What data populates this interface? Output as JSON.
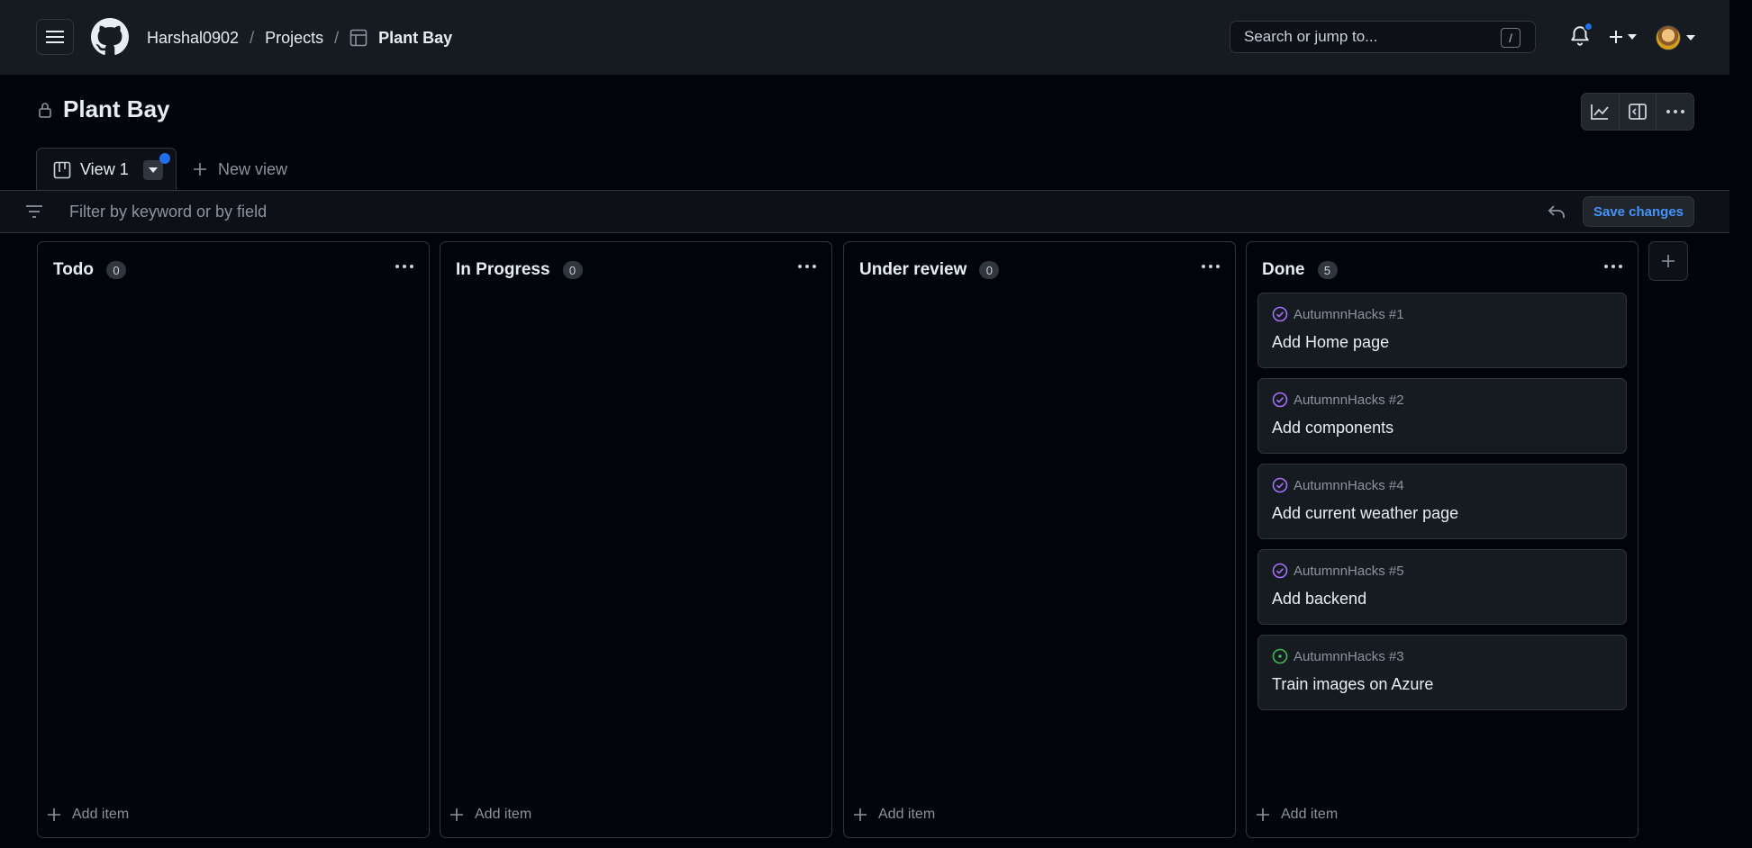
{
  "header": {
    "breadcrumb_owner": "Harshal0902",
    "breadcrumb_projects": "Projects",
    "breadcrumb_project": "Plant Bay",
    "separator": "/",
    "search_placeholder": "Search or jump to...",
    "search_shortcut": "/"
  },
  "project": {
    "title": "Plant Bay"
  },
  "views": {
    "active_tab": "View 1",
    "new_view_label": "New view"
  },
  "filter": {
    "placeholder": "Filter by keyword or by field",
    "save_label": "Save changes"
  },
  "columns": [
    {
      "title": "Todo",
      "count": "0",
      "add_label": "Add item",
      "cards": []
    },
    {
      "title": "In Progress",
      "count": "0",
      "add_label": "Add item",
      "cards": []
    },
    {
      "title": "Under review",
      "count": "0",
      "add_label": "Add item",
      "cards": []
    },
    {
      "title": "Done",
      "count": "5",
      "add_label": "Add item",
      "cards": [
        {
          "ref": "AutumnnHacks #1",
          "title": "Add Home page",
          "status": "closed",
          "status_color": "#a371f7"
        },
        {
          "ref": "AutumnnHacks #2",
          "title": "Add components",
          "status": "closed",
          "status_color": "#a371f7"
        },
        {
          "ref": "AutumnnHacks #4",
          "title": "Add current weather page",
          "status": "closed",
          "status_color": "#a371f7"
        },
        {
          "ref": "AutumnnHacks #5",
          "title": "Add backend",
          "status": "closed",
          "status_color": "#a371f7"
        },
        {
          "ref": "AutumnnHacks #3",
          "title": "Train images on Azure",
          "status": "open",
          "status_color": "#3fb950"
        }
      ]
    }
  ],
  "colors": {
    "accent": "#4493f8",
    "notification_dot": "#1f6feb",
    "closed": "#a371f7",
    "open": "#3fb950"
  }
}
